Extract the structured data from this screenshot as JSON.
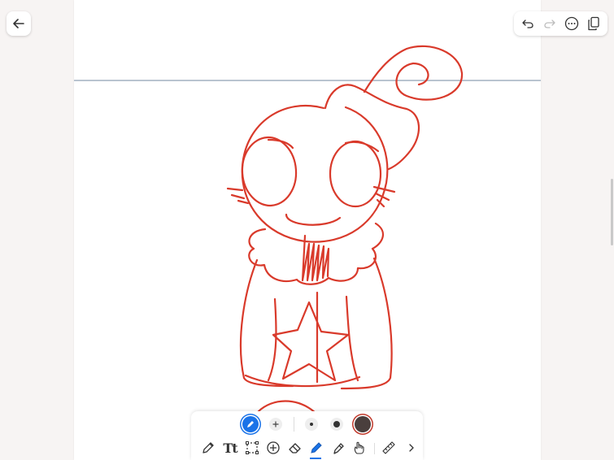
{
  "app": {
    "navigation": {
      "back_icon": "arrow-left-icon"
    },
    "top_toolbar": {
      "items": [
        {
          "icon": "undo-icon",
          "enabled": true
        },
        {
          "icon": "redo-icon",
          "enabled": false
        },
        {
          "icon": "more-options-icon",
          "enabled": true
        },
        {
          "icon": "copy-page-icon",
          "enabled": true
        }
      ]
    },
    "stroke_color": "#d93a2b",
    "pen_options": {
      "active_tool_icon": "pen-icon",
      "add_icon": "plus-icon",
      "sizes": [
        "small",
        "large"
      ],
      "selected_color": "#4a3f3d",
      "accent": "#1a73e8"
    },
    "tools": [
      {
        "icon": "pencil-icon",
        "active": false
      },
      {
        "icon": "text-icon",
        "label": "Tt",
        "active": false
      },
      {
        "icon": "lasso-select-icon",
        "active": false
      },
      {
        "icon": "add-shape-icon",
        "active": false
      },
      {
        "icon": "eraser-icon",
        "active": false
      },
      {
        "icon": "pen-icon",
        "active": true
      },
      {
        "icon": "highlighter-icon",
        "active": false
      },
      {
        "icon": "touch-draw-icon",
        "active": false
      },
      {
        "icon": "ruler-icon",
        "active": false
      },
      {
        "icon": "chevron-right-icon",
        "active": false
      }
    ]
  }
}
